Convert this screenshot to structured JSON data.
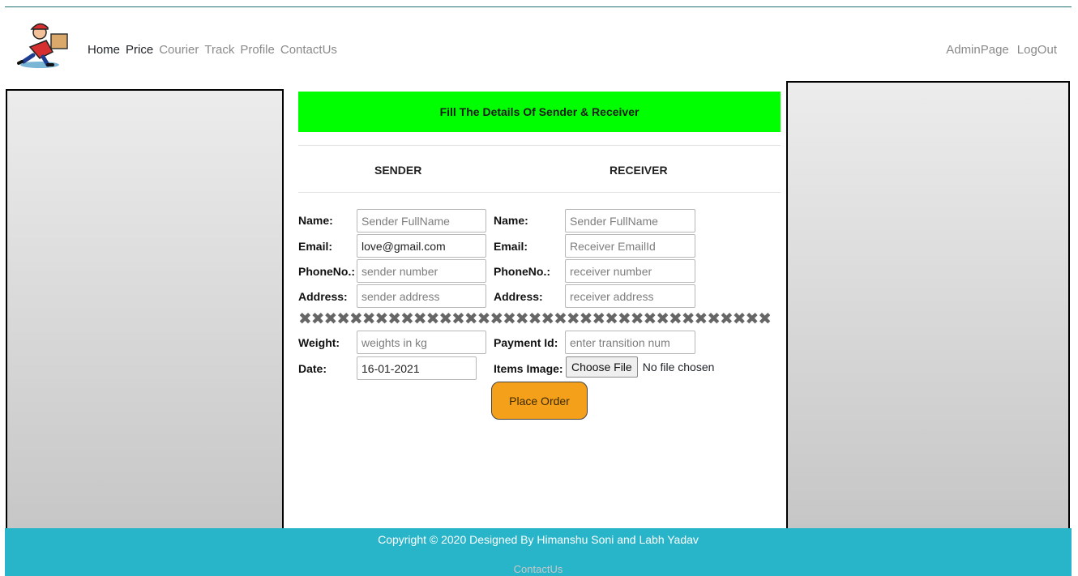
{
  "nav": {
    "links": [
      {
        "label": "Home",
        "color": "#212529"
      },
      {
        "label": "Price",
        "color": "#212529"
      },
      {
        "label": "Courier",
        "color": "#8a8a8a"
      },
      {
        "label": "Track",
        "color": "#8a8a8a"
      },
      {
        "label": "Profile",
        "color": "#8a8a8a"
      },
      {
        "label": "ContactUs",
        "color": "#8a8a8a"
      }
    ],
    "right": {
      "admin": "AdminPage",
      "logout": "LogOut"
    }
  },
  "banner": {
    "text": "Fill The Details Of Sender & Receiver",
    "color": "#00ff00"
  },
  "sender": {
    "heading": "SENDER",
    "name_label": "Name:",
    "name_placeholder": "Sender FullName",
    "email_label": "Email:",
    "email_value": "love@gmail.com",
    "phone_label": "PhoneNo.:",
    "phone_placeholder": "sender number",
    "address_label": "Address:",
    "address_placeholder": "sender address"
  },
  "receiver": {
    "heading": "RECEIVER",
    "name_label": "Name:",
    "name_placeholder": "Sender FullName",
    "email_label": "Email:",
    "email_placeholder": "Receiver EmailId",
    "phone_label": "PhoneNo.:",
    "phone_placeholder": "receiver number",
    "address_label": "Address:",
    "address_placeholder": "receiver address"
  },
  "divider": "✖✖✖✖✖✖✖✖✖✖✖✖✖✖✖✖✖✖✖✖✖✖✖✖✖✖✖✖✖✖✖✖✖✖✖✖✖",
  "order": {
    "weight_label": "Weight:",
    "weight_placeholder": "weights in kg",
    "date_label": "Date:",
    "date_value": "16-01-2021",
    "payment_label": "Payment Id:",
    "payment_placeholder": "enter transition num",
    "image_label": "Items Image:",
    "file_button": "Choose File",
    "file_status": "No file chosen",
    "submit": "Place Order"
  },
  "footer": {
    "copyright": "Copyright © 2020 Designed By Himanshu Soni and Labh Yadav",
    "contact": "ContactUs",
    "color": "#29b5c9"
  },
  "icons": {
    "logo": "courier-delivery-logo"
  }
}
